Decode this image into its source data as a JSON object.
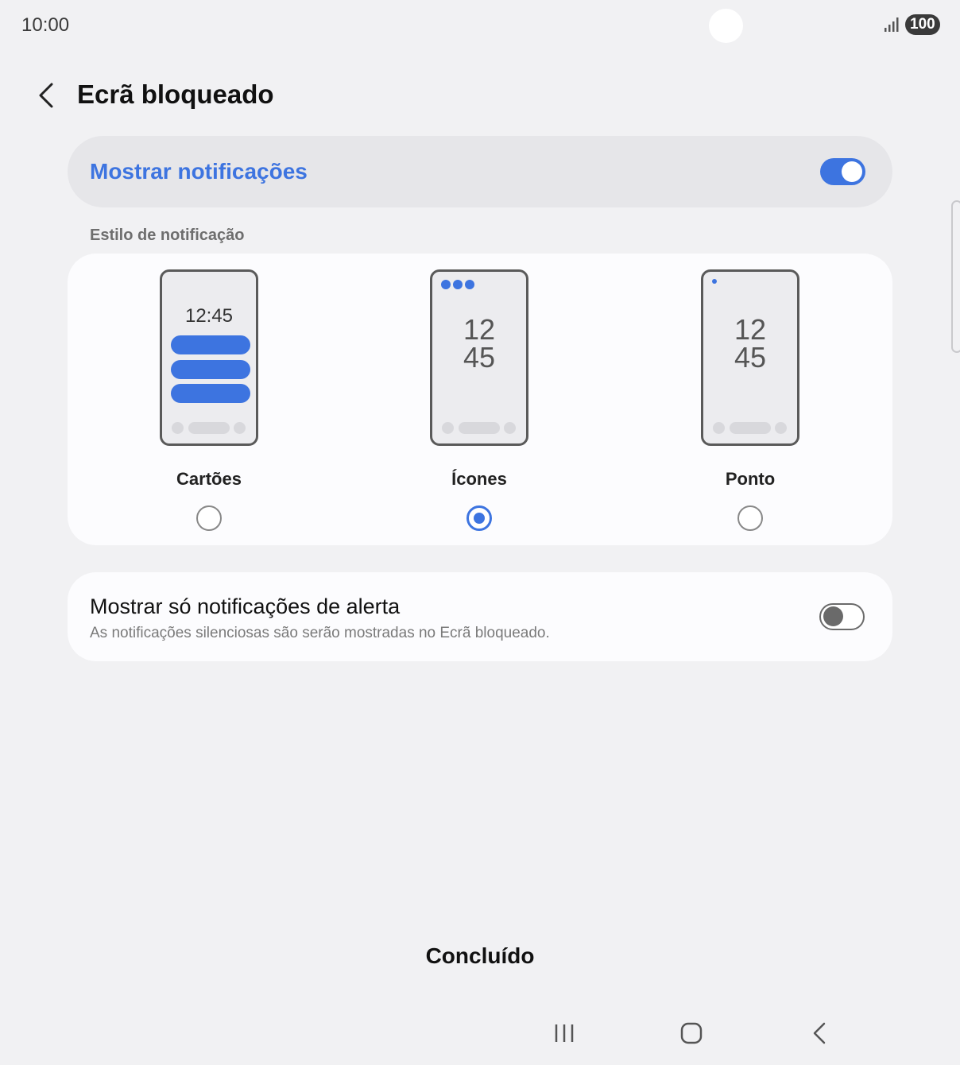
{
  "status_bar": {
    "time": "10:00",
    "battery": "100",
    "signal_icon": "signal-bars-icon"
  },
  "header": {
    "title": "Ecrã bloqueado",
    "back_icon": "chevron-left-icon"
  },
  "show_notifications": {
    "label": "Mostrar notificações",
    "enabled": true
  },
  "notification_style": {
    "section_label": "Estilo de notificação",
    "options": [
      {
        "label": "Cartões",
        "selected": false,
        "preview_clock": "12:45"
      },
      {
        "label": "Ícones",
        "selected": true,
        "preview_hour": "12",
        "preview_minute": "45"
      },
      {
        "label": "Ponto",
        "selected": false,
        "preview_hour": "12",
        "preview_minute": "45"
      }
    ]
  },
  "alert_only": {
    "title": "Mostrar só notificações de alerta",
    "subtitle": "As notificações silenciosas são serão mostradas no Ecrã bloqueado.",
    "enabled": false
  },
  "footer": {
    "done_label": "Concluído"
  },
  "navbar": {
    "recents_icon": "recents-icon",
    "home_icon": "home-icon",
    "back_icon": "back-arrow-icon"
  },
  "colors": {
    "accent": "#3d74e0",
    "background": "#f1f1f3",
    "card": "#fcfcfe"
  }
}
